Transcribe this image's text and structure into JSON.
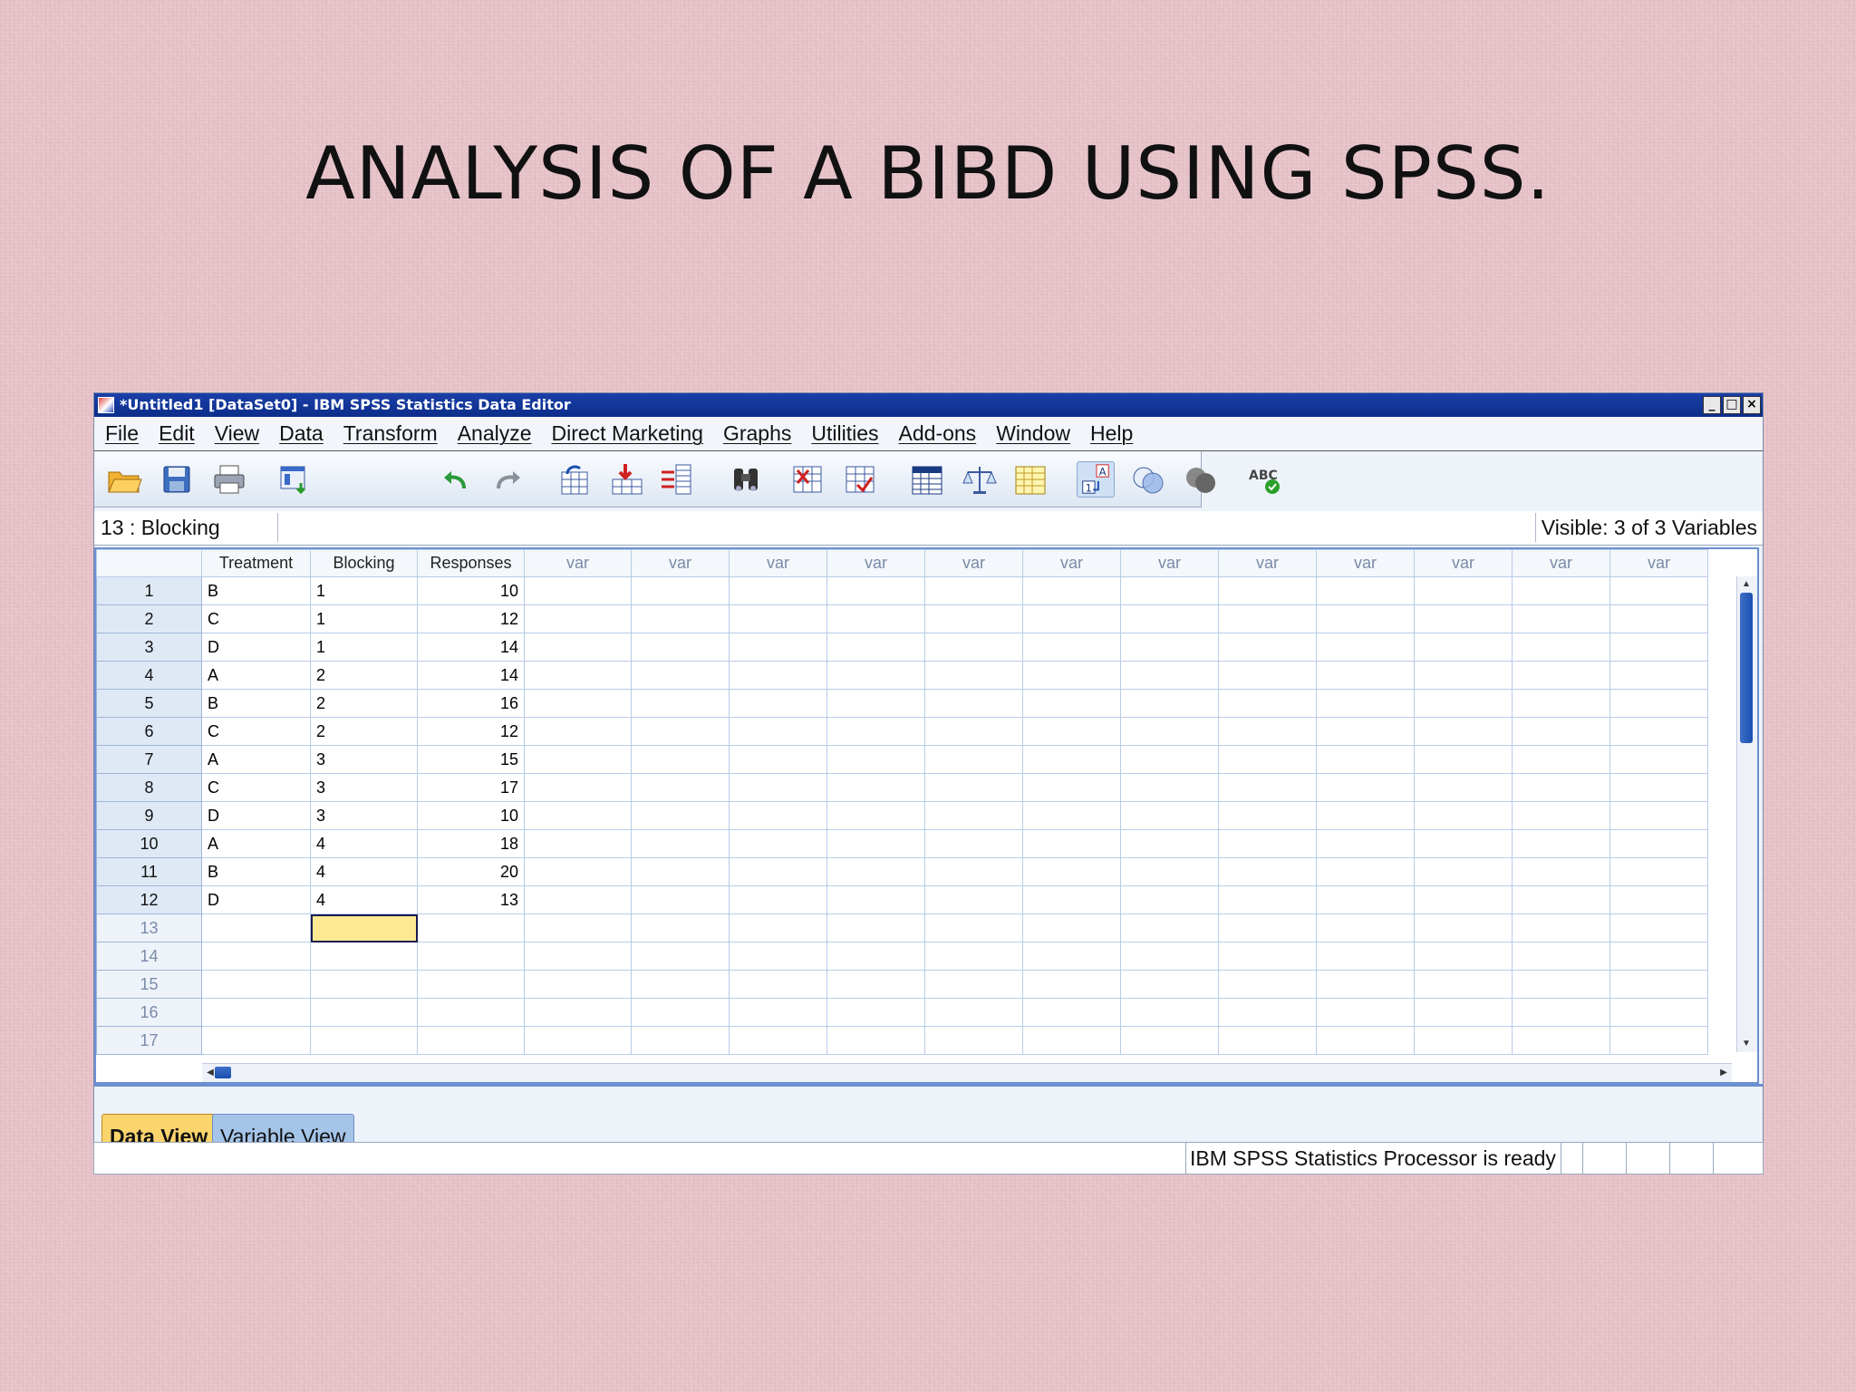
{
  "slide": {
    "title": "ANALYSIS OF A BIBD USING SPSS."
  },
  "window": {
    "title": "*Untitled1 [DataSet0] - IBM SPSS Statistics Data Editor",
    "controls": {
      "minimize": "_",
      "maximize": "□",
      "close": "×"
    }
  },
  "menu": [
    "File",
    "Edit",
    "View",
    "Data",
    "Transform",
    "Analyze",
    "Direct Marketing",
    "Graphs",
    "Utilities",
    "Add-ons",
    "Window",
    "Help"
  ],
  "toolbar": {
    "icons": [
      "open-folder-icon",
      "save-icon",
      "print-icon",
      "recall-dialog-icon",
      "undo-icon",
      "redo-icon",
      "goto-case-icon",
      "goto-variable-icon",
      "variables-icon",
      "find-icon",
      "insert-cases-icon",
      "insert-variable-icon",
      "split-file-icon",
      "weight-cases-icon",
      "select-cases-icon",
      "value-labels-icon",
      "use-sets-icon",
      "show-all-variables-icon",
      "spell-check-icon"
    ],
    "spellcheck_label": "ABC"
  },
  "cell_editor": {
    "reference": "13 : Blocking",
    "value": "",
    "visible_info": "Visible: 3 of 3 Variables"
  },
  "grid": {
    "columns": [
      "Treatment",
      "Blocking",
      "Responses",
      "var",
      "var",
      "var",
      "var",
      "var",
      "var",
      "var",
      "var",
      "var",
      "var",
      "var",
      "var"
    ],
    "rows": [
      [
        "1",
        "B",
        "1",
        "10"
      ],
      [
        "2",
        "C",
        "1",
        "12"
      ],
      [
        "3",
        "D",
        "1",
        "14"
      ],
      [
        "4",
        "A",
        "2",
        "14"
      ],
      [
        "5",
        "B",
        "2",
        "16"
      ],
      [
        "6",
        "C",
        "2",
        "12"
      ],
      [
        "7",
        "A",
        "3",
        "15"
      ],
      [
        "8",
        "C",
        "3",
        "17"
      ],
      [
        "9",
        "D",
        "3",
        "10"
      ],
      [
        "10",
        "A",
        "4",
        "18"
      ],
      [
        "11",
        "B",
        "4",
        "20"
      ],
      [
        "12",
        "D",
        "4",
        "13"
      ]
    ],
    "empty_rows": [
      "13",
      "14",
      "15",
      "16",
      "17"
    ],
    "active_cell": {
      "row": "13",
      "column": "Blocking"
    }
  },
  "tabs": {
    "data_view": "Data View",
    "variable_view": "Variable View"
  },
  "status": {
    "text": "IBM SPSS Statistics Processor is ready"
  },
  "colors": {
    "titlebar": "#0c2d8a",
    "active_tab": "#fbd46c",
    "active_cell": "#fde992",
    "grid_border": "#6b8fd0",
    "scroll_thumb": "#1a4fb0"
  }
}
